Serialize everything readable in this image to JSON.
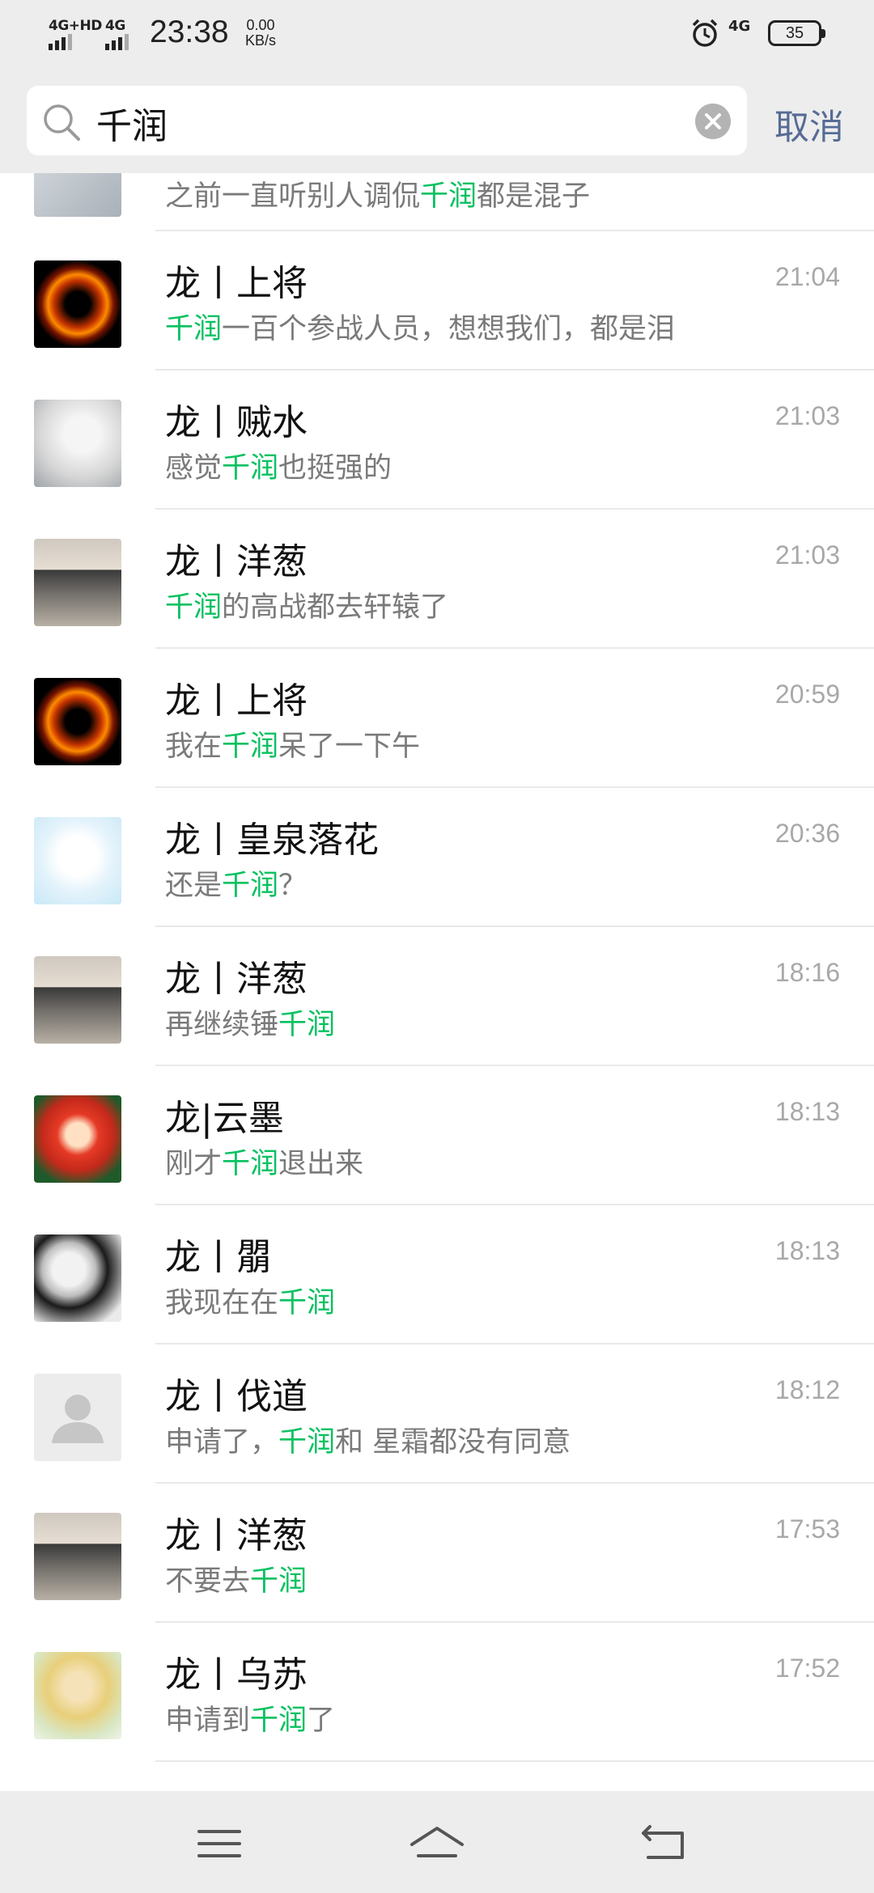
{
  "status_bar": {
    "network_left": "4G+HD",
    "network_left2": "4G",
    "time": "23:38",
    "speed_value": "0.00",
    "speed_unit": "KB/s",
    "network_right": "4G",
    "battery": "35",
    "icons": [
      "signal-icon",
      "alarm-icon",
      "battery-icon"
    ]
  },
  "search": {
    "query": "千润",
    "cancel_label": "取消",
    "icons": [
      "search-icon",
      "clear-icon"
    ]
  },
  "colors": {
    "highlight": "#07c160",
    "link": "#576b95",
    "header_bg": "#ededed"
  },
  "partial_result": {
    "snippet": {
      "pre": "之前一直听别人调侃",
      "hl": "千润",
      "post": "都是混子"
    }
  },
  "results": [
    {
      "name": "龙丨上将",
      "time": "21:04",
      "pre": "",
      "hl": "千润",
      "post": "一百个参战人员，想想我们，都是泪"
    },
    {
      "name": "龙丨贼水",
      "time": "21:03",
      "pre": "感觉",
      "hl": "千润",
      "post": "也挺强的"
    },
    {
      "name": "龙丨洋葱",
      "time": "21:03",
      "pre": "",
      "hl": "千润",
      "post": "的高战都去轩辕了"
    },
    {
      "name": "龙丨上将",
      "time": "20:59",
      "pre": "我在",
      "hl": "千润",
      "post": "呆了一下午"
    },
    {
      "name": "龙丨皇泉落花",
      "time": "20:36",
      "pre": "还是",
      "hl": "千润",
      "post": "？"
    },
    {
      "name": "龙丨洋葱",
      "time": "18:16",
      "pre": "再继续锤",
      "hl": "千润",
      "post": ""
    },
    {
      "name": "龙|云墨",
      "time": "18:13",
      "pre": "刚才",
      "hl": "千润",
      "post": "退出来"
    },
    {
      "name": "龙丨朤",
      "time": "18:13",
      "pre": "我现在在",
      "hl": "千润",
      "post": ""
    },
    {
      "name": "龙丨伐道",
      "time": "18:12",
      "pre": "申请了，",
      "hl": "千润",
      "post": "和 星霜都没有同意"
    },
    {
      "name": "龙丨洋葱",
      "time": "17:53",
      "pre": "不要去",
      "hl": "千润",
      "post": ""
    },
    {
      "name": "龙丨乌苏",
      "time": "17:52",
      "pre": "申请到",
      "hl": "千润",
      "post": "了"
    }
  ],
  "nav_bar": {
    "buttons": [
      "menu-icon",
      "home-icon",
      "back-icon"
    ]
  }
}
